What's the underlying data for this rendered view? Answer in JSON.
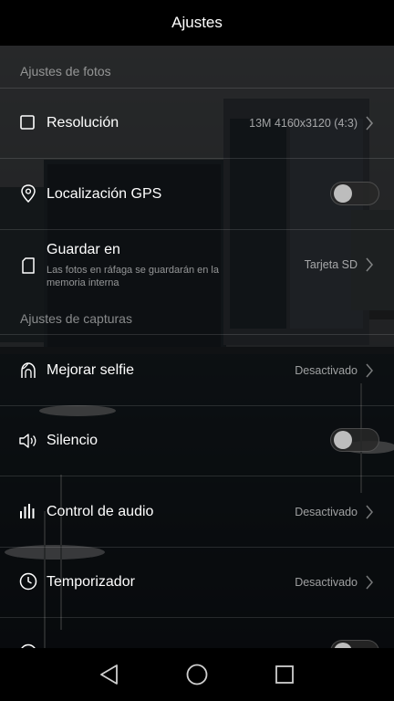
{
  "header": {
    "title": "Ajustes"
  },
  "sections": {
    "photo": "Ajustes de fotos",
    "capture": "Ajustes de capturas"
  },
  "rows": {
    "resolution": {
      "label": "Resolución",
      "value": "13M 4160x3120 (4:3)"
    },
    "gps": {
      "label": "Localización GPS",
      "toggle_on": false
    },
    "save_to": {
      "label": "Guardar en",
      "sub": "Las fotos en ráfaga se guardarán en la memoria interna",
      "value": "Tarjeta SD"
    },
    "beauty": {
      "label": "Mejorar selfie",
      "value": "Desactivado"
    },
    "mute": {
      "label": "Silencio",
      "toggle_on": false
    },
    "audio": {
      "label": "Control de audio",
      "value": "Desactivado"
    },
    "timer": {
      "label": "Temporizador",
      "value": "Desactivado"
    },
    "partial": {
      "toggle_on": false
    }
  },
  "icons": {
    "resolution": "square-icon",
    "gps": "location-pin-icon",
    "save_to": "document-icon",
    "beauty": "selfie-icon",
    "mute": "speaker-icon",
    "audio": "audio-bars-icon",
    "timer": "clock-icon",
    "back": "back-triangle-icon",
    "home": "home-circle-icon",
    "recents": "recents-square-icon"
  },
  "colors": {
    "text": "#ffffff",
    "secondary": "#9a9a9a",
    "bar": "#000000"
  }
}
